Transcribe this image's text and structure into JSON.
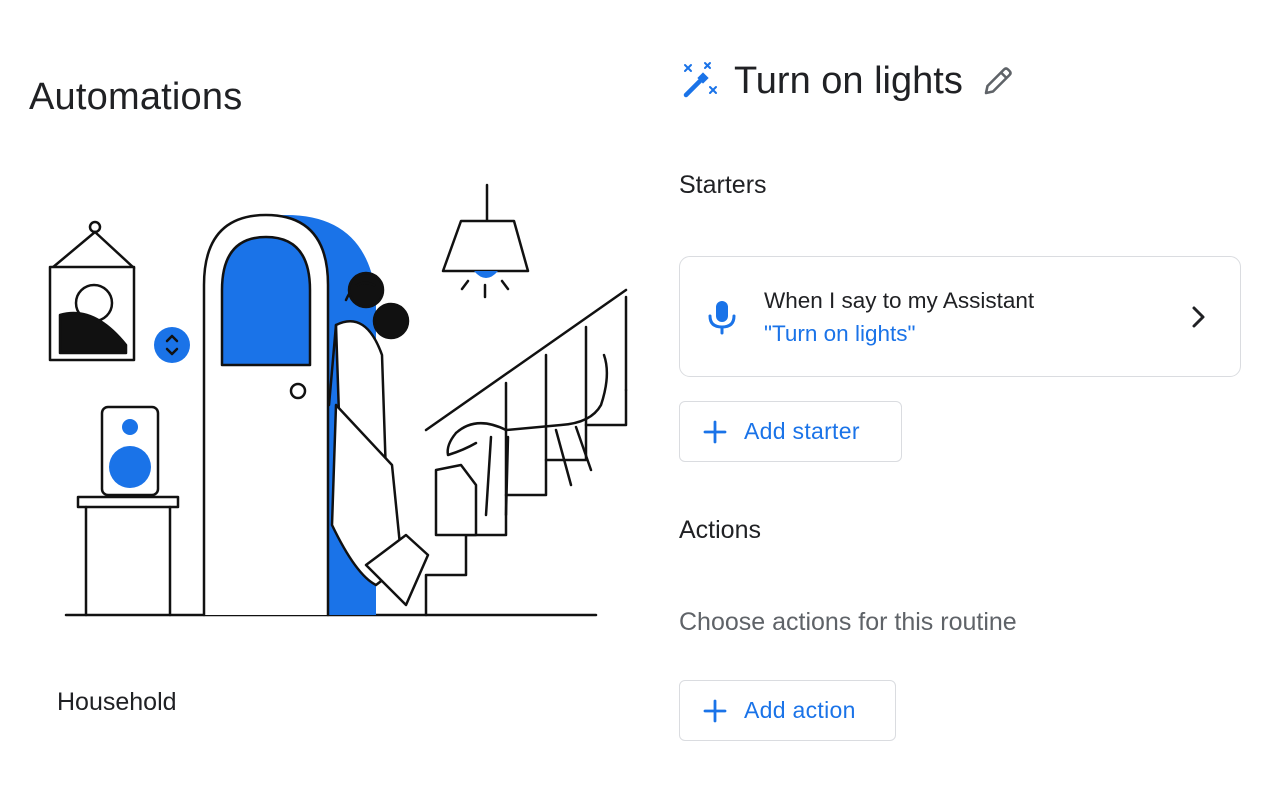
{
  "left_panel": {
    "title": "Automations",
    "household_label": "Household"
  },
  "routine": {
    "title": "Turn on lights",
    "header_icon": "magic-wand-icon",
    "edit_icon": "pencil-icon",
    "starters_heading": "Starters",
    "starter": {
      "icon": "microphone-icon",
      "title": "When I say to my Assistant",
      "phrase": "\"Turn on lights\"",
      "chevron_icon": "chevron-right-icon"
    },
    "add_starter_label": "Add starter",
    "actions_heading": "Actions",
    "actions_hint": "Choose actions for this routine",
    "add_action_label": "Add action"
  },
  "colors": {
    "accent_blue": "#1a73e8",
    "text_primary": "#202124",
    "text_secondary": "#5f6368",
    "border": "#dadce0"
  }
}
